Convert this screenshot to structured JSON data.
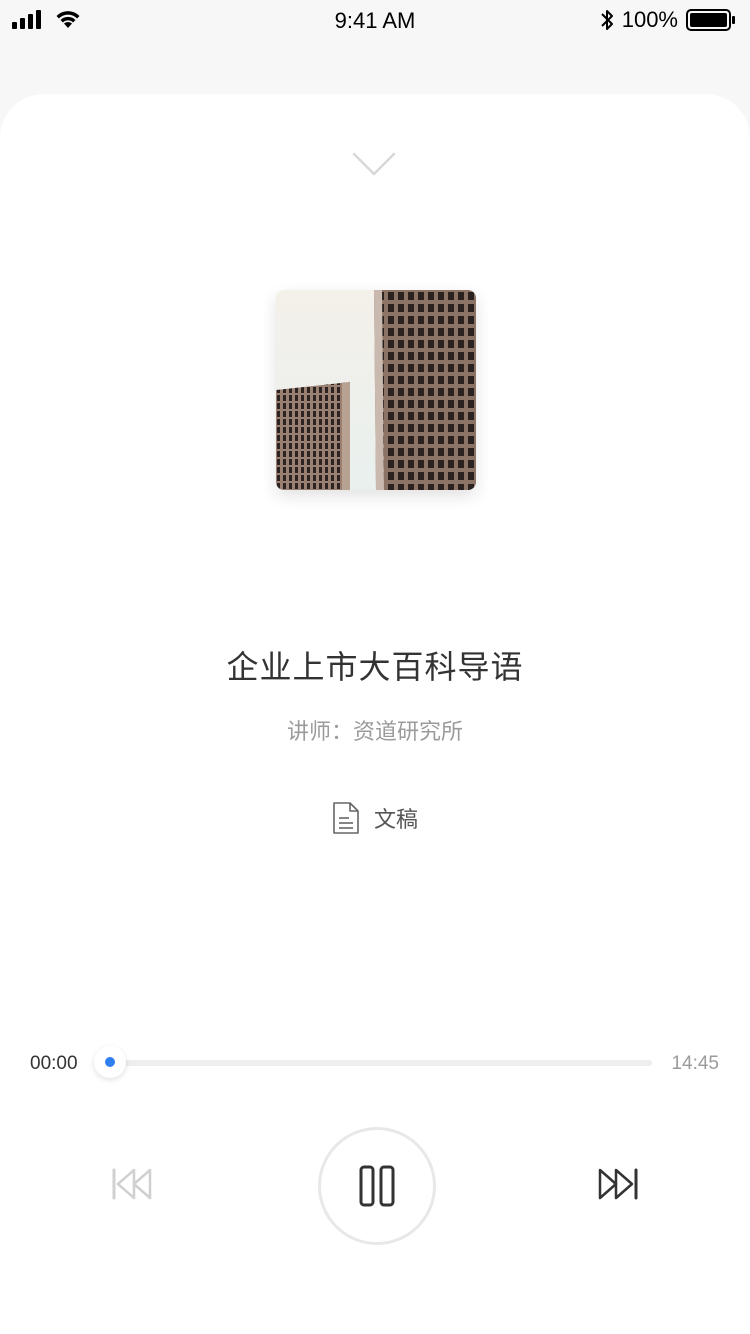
{
  "status_bar": {
    "time": "9:41 AM",
    "battery": "100%",
    "icons": [
      "signal-icon",
      "wifi-icon",
      "bluetooth-icon",
      "battery-icon"
    ]
  },
  "player": {
    "collapse_icon": "chevron-down-icon",
    "cover_icon": "album-cover",
    "title": "企业上市大百科导语",
    "lecturer": "讲师：资道研究所",
    "transcript_label": "文稿",
    "transcript_icon": "document-icon",
    "current_time": "00:00",
    "total_time": "14:45",
    "progress": 0,
    "controls": {
      "prev_icon": "skip-back-icon",
      "play_state": "playing",
      "pause_icon": "pause-icon",
      "next_icon": "skip-forward-icon"
    },
    "accent_color": "#2f7ff0"
  }
}
